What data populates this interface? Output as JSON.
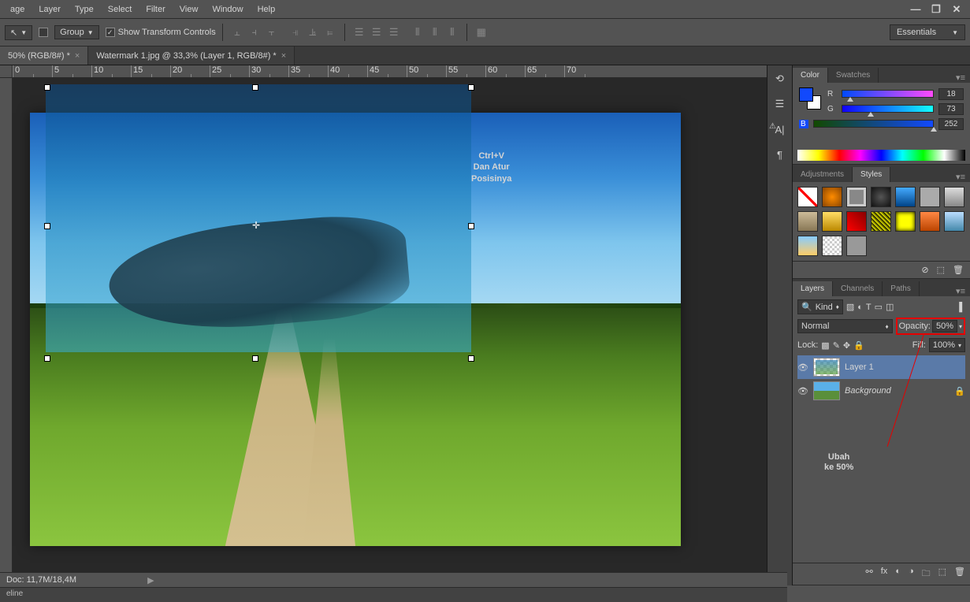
{
  "menu": {
    "items": [
      "age",
      "Layer",
      "Type",
      "Select",
      "Filter",
      "View",
      "Window",
      "Help"
    ]
  },
  "winctrl": {
    "min": "—",
    "max": "❐",
    "close": "✕"
  },
  "options": {
    "arrow_icon": "↖",
    "group": "Group",
    "show_transform": "Show Transform Controls",
    "workspace": "Essentials"
  },
  "tabs": [
    {
      "label": "50% (RGB/8#) *",
      "active": false
    },
    {
      "label": "Watermark 1.jpg @ 33,3% (Layer 1, RGB/8#) *",
      "active": true
    }
  ],
  "ruler": [
    "0",
    "5",
    "10",
    "15",
    "20",
    "25",
    "30",
    "35",
    "40",
    "45",
    "50",
    "55",
    "60",
    "65",
    "70"
  ],
  "canvas_annot": {
    "l1": "Ctrl+V",
    "l2": "Dan Atur",
    "l3": "Posisinya"
  },
  "right_annot": {
    "l1": "Ubah",
    "l2": "ke 50%"
  },
  "panels": {
    "color": {
      "tab1": "Color",
      "tab2": "Swatches",
      "r": "R",
      "g": "G",
      "b": "B",
      "rv": "18",
      "gv": "73",
      "bv": "252"
    },
    "adj": {
      "tab1": "Adjustments",
      "tab2": "Styles"
    },
    "layers": {
      "tab1": "Layers",
      "tab2": "Channels",
      "tab3": "Paths",
      "kind": "Kind",
      "blend": "Normal",
      "opacity_lbl": "Opacity:",
      "opacity_v": "50%",
      "lock": "Lock:",
      "fill_lbl": "Fill:",
      "fill_v": "100%",
      "layer1": "Layer 1",
      "bg": "Background"
    }
  },
  "status": {
    "doc": "Doc: 11,7M/18,4M"
  },
  "timeline": "eline"
}
